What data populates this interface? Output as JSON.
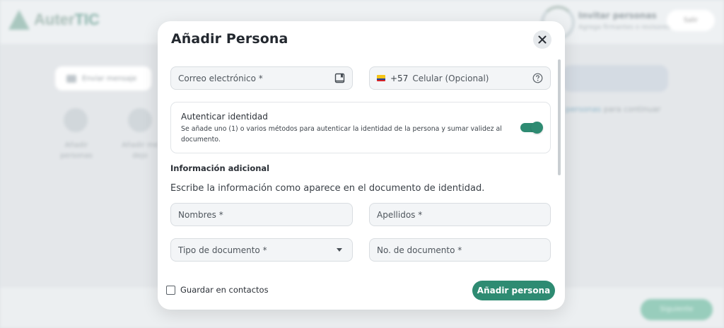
{
  "background": {
    "logo_text": "Auter",
    "logo_text_accent": "TIC",
    "header_title": "Invitar personas",
    "header_subtitle": "Agrega firmantes o revisores",
    "header_button": "Salir",
    "send_message_label": "Enviar mensaje",
    "add_person_label": "Añadir personas",
    "add_me_label": "Añadir me dejo",
    "right_hint_prefix": "",
    "right_hint_link": "personas",
    "right_hint_suffix": "para continuar",
    "float_button": "Siguiente"
  },
  "modal": {
    "title": "Añadir Persona",
    "email_placeholder": "Correo electrónico *",
    "phone_code": "+57",
    "phone_placeholder": "Celular (Opcional)",
    "auth_title": "Autenticar identidad",
    "auth_description": "Se añade uno (1) o varios métodos para autenticar la identidad de la persona y sumar validez al documento.",
    "auth_enabled": true,
    "section_title": "Información adicional",
    "instructions": "Escribe la información como aparece en el documento de identidad.",
    "nombres_placeholder": "Nombres *",
    "apellidos_placeholder": "Apellidos *",
    "tipo_documento_label": "Tipo de documento *",
    "numero_documento_placeholder": "No. de documento *",
    "save_contacts_label": "Guardar en contactos",
    "save_contacts_checked": false,
    "submit_label": "Añadir persona"
  },
  "colors": {
    "accent": "#2e8b72",
    "flag_yellow": "#f5c518",
    "flag_blue": "#1f3f99",
    "flag_red": "#d2232a"
  },
  "icons": {
    "email_trailing": "contact-book-icon",
    "phone_trailing": "help-circle-icon",
    "close": "close-icon",
    "dropdown": "chevron-down-icon"
  }
}
